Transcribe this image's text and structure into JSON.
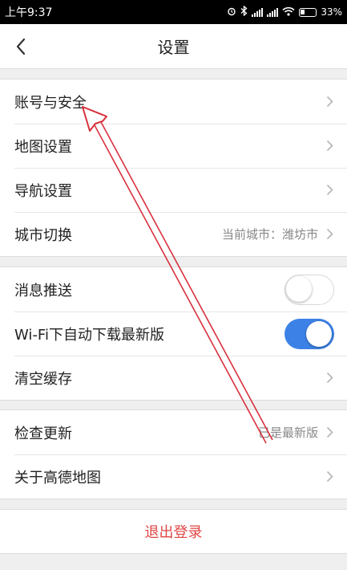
{
  "status_bar": {
    "time": "上午9:37",
    "battery": "33%"
  },
  "header": {
    "title": "设置"
  },
  "groups": [
    {
      "items": [
        {
          "label": "账号与安全"
        },
        {
          "label": "地图设置"
        },
        {
          "label": "导航设置"
        },
        {
          "label": "城市切换",
          "value": "当前城市：潍坊市"
        }
      ]
    },
    {
      "items": [
        {
          "label": "消息推送",
          "toggle": false
        },
        {
          "label": "Wi-Fi下自动下载最新版",
          "toggle": true
        },
        {
          "label": "清空缓存"
        }
      ]
    },
    {
      "items": [
        {
          "label": "检查更新",
          "value": "已是最新版"
        },
        {
          "label": "关于高德地图"
        }
      ]
    }
  ],
  "logout": {
    "label": "退出登录"
  },
  "colors": {
    "accent": "#3c82e6",
    "logout_text": "#e04646",
    "annotation_arrow": "#d8313d",
    "background": "#efeff0"
  }
}
